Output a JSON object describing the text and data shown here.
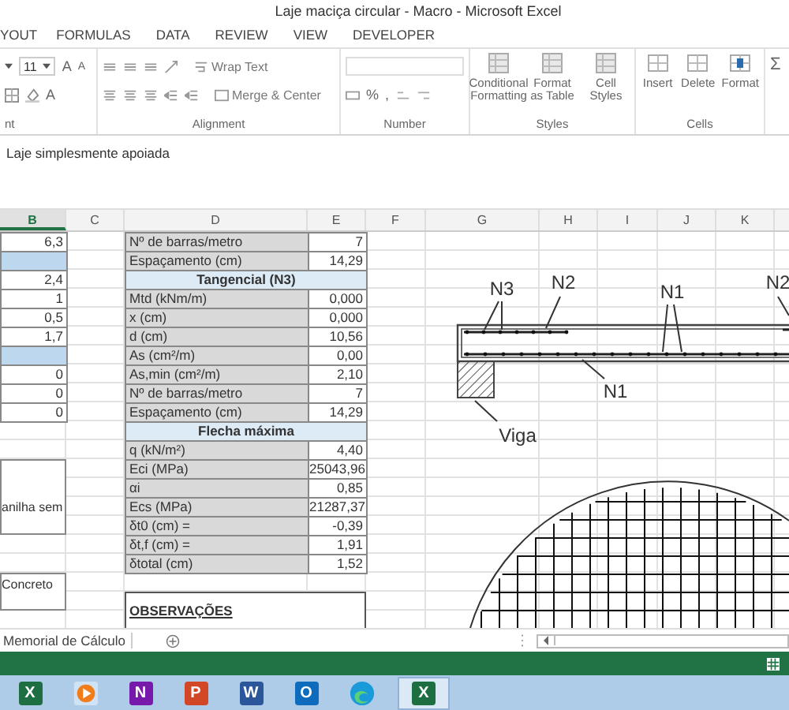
{
  "window": {
    "title": "Laje maciça circular - Macro - Microsoft Excel"
  },
  "ribbon_tabs": [
    "YOUT",
    "FORMULAS",
    "DATA",
    "REVIEW",
    "VIEW",
    "DEVELOPER"
  ],
  "ribbon": {
    "font": {
      "size": "11",
      "grow": "A",
      "shrink": "A",
      "color_glyph": "A",
      "label": "nt"
    },
    "alignment": {
      "wrap": "Wrap Text",
      "merge": "Merge & Center",
      "label": "Alignment"
    },
    "number": {
      "percent": "%",
      "comma": ",",
      "label": "Number"
    },
    "styles": {
      "buttons": [
        "Conditional Formatting",
        "Format as Table",
        "Cell Styles"
      ],
      "label": "Styles"
    },
    "cells": {
      "buttons": [
        "Insert",
        "Delete",
        "Format"
      ],
      "label": "Cells"
    },
    "editing": {
      "sum": "Σ"
    }
  },
  "formula_bar": {
    "value": "Laje simplesmente apoiada"
  },
  "columns": [
    {
      "label": "B",
      "selected": true
    },
    {
      "label": "C",
      "selected": false
    },
    {
      "label": "D",
      "selected": false
    },
    {
      "label": "E",
      "selected": false
    },
    {
      "label": "F",
      "selected": false
    },
    {
      "label": "G",
      "selected": false
    },
    {
      "label": "H",
      "selected": false
    },
    {
      "label": "I",
      "selected": false
    },
    {
      "label": "J",
      "selected": false
    },
    {
      "label": "K",
      "selected": false
    }
  ],
  "rows": [
    {
      "column_b": {
        "kind": "value",
        "text": "6,3"
      },
      "kind": "pair",
      "label": "Nº de barras/metro",
      "value": "7"
    },
    {
      "column_b": {
        "kind": "header"
      },
      "kind": "pair",
      "label": "Espaçamento (cm)",
      "value": "14,29"
    },
    {
      "column_b": {
        "kind": "value",
        "text": "2,4"
      },
      "kind": "header",
      "label": "Tangencial (N3)"
    },
    {
      "column_b": {
        "kind": "value",
        "text": "1"
      },
      "kind": "pair",
      "label": "Mtd (kNm/m)",
      "value": "0,000"
    },
    {
      "column_b": {
        "kind": "value",
        "text": "0,5"
      },
      "kind": "pair",
      "label": "x (cm)",
      "value": "0,000"
    },
    {
      "column_b": {
        "kind": "value",
        "text": "1,7"
      },
      "kind": "pair",
      "label": "d (cm)",
      "value": "10,56"
    },
    {
      "column_b": {
        "kind": "header"
      },
      "kind": "pair",
      "label": "As (cm²/m)",
      "value": "0,00"
    },
    {
      "column_b": {
        "kind": "value",
        "text": "0"
      },
      "kind": "pair",
      "label": "As,min (cm²/m)",
      "value": "2,10"
    },
    {
      "column_b": {
        "kind": "value",
        "text": "0"
      },
      "kind": "pair",
      "label": "Nº de barras/metro",
      "value": "7"
    },
    {
      "column_b": {
        "kind": "value",
        "text": "0"
      },
      "kind": "pair",
      "label": "Espaçamento (cm)",
      "value": "14,29"
    },
    {
      "kind": "header",
      "label": "Flecha máxima"
    },
    {
      "kind": "pair",
      "label": "q (kN/m²)",
      "value": "4,40"
    },
    {
      "kind": "pair",
      "label": "Eci (MPa)",
      "value": "25043,96"
    },
    {
      "kind": "pair",
      "label": "αi",
      "value": "0,85"
    },
    {
      "kind": "pair",
      "label": "Ecs (MPa)",
      "value": "21287,37"
    },
    {
      "kind": "pair",
      "label": "δt0 (cm) =",
      "value": "-0,39"
    },
    {
      "kind": "pair",
      "label": "δt,f (cm) =",
      "value": "1,91"
    },
    {
      "kind": "pair",
      "label": "δtotal (cm)",
      "value": "1,52"
    }
  ],
  "notes": [
    "anilha sem",
    "Concreto"
  ],
  "observations": "OBSERVAÇÕES",
  "drawing": {
    "labels": [
      "N3",
      "N2",
      "N1",
      "N2",
      "N1",
      "Viga"
    ]
  },
  "sheet_tabs": [
    "Memorial de Cálculo"
  ],
  "taskbar": [
    {
      "kind": "letter",
      "letter": "X",
      "color": "#1d6f42",
      "selected": false
    },
    {
      "kind": "player",
      "color": "#f07d1a",
      "selected": false
    },
    {
      "kind": "letter",
      "letter": "N",
      "color": "#7719aa",
      "selected": false
    },
    {
      "kind": "letter",
      "letter": "P",
      "color": "#d24726",
      "selected": false
    },
    {
      "kind": "letter",
      "letter": "W",
      "color": "#2b579a",
      "selected": false
    },
    {
      "kind": "letter",
      "letter": "O",
      "color": "#0f6cbd",
      "selected": false
    },
    {
      "kind": "edge",
      "color": "#1a9ad8",
      "selected": false
    },
    {
      "kind": "letter",
      "letter": "X",
      "color": "#1d6f42",
      "selected": true
    }
  ]
}
